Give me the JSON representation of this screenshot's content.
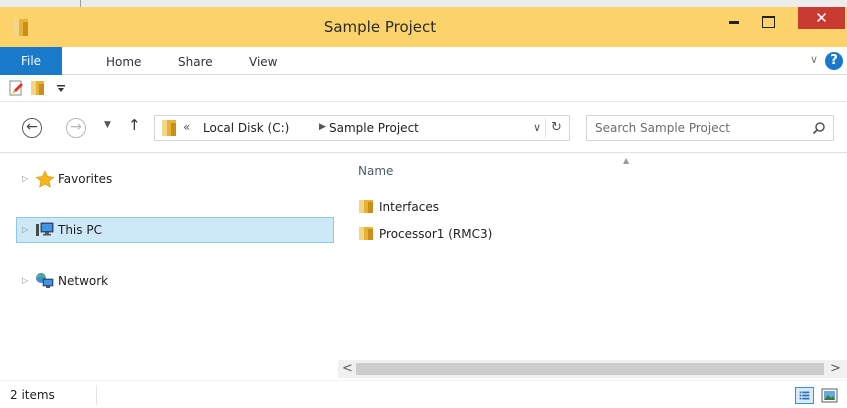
{
  "window": {
    "title": "Sample Project",
    "minimize_glyph": "–",
    "maximize_glyph": "□",
    "close_glyph": "✕",
    "colors": {
      "title_bar": "#fbd36a",
      "accent": "#1979ca",
      "close": "#c93a30",
      "selection": "#cde8f7"
    }
  },
  "ribbon": {
    "tabs": [
      {
        "label": "File"
      },
      {
        "label": "Home"
      },
      {
        "label": "Share"
      },
      {
        "label": "View"
      }
    ],
    "expand_glyph": "∨",
    "help_glyph": "?"
  },
  "quick_access": {
    "icons": [
      "properties-icon",
      "new-folder-icon",
      "customize-dropdown-icon"
    ]
  },
  "navigation": {
    "back_glyph": "←",
    "forward_glyph": "→",
    "recent_glyph": "▼",
    "up_glyph": "↑",
    "address": {
      "overflow_glyph": "«",
      "separator_glyph": "▶",
      "crumbs": [
        {
          "label": "Local Disk (C:)"
        },
        {
          "label": "Sample Project"
        }
      ],
      "dropdown_glyph": "∨",
      "refresh_glyph": "↻"
    },
    "search": {
      "placeholder": "Search Sample Project"
    }
  },
  "nav_pane": {
    "expand_glyph": "▷",
    "items": [
      {
        "label": "Favorites",
        "icon": "star-icon",
        "selected": false
      },
      {
        "label": "This PC",
        "icon": "computer-icon",
        "selected": true
      },
      {
        "label": "Network",
        "icon": "network-icon",
        "selected": false
      }
    ]
  },
  "content": {
    "columns": [
      {
        "label": "Name",
        "sorted": "ascending"
      }
    ],
    "sort_glyph": "▲",
    "items": [
      {
        "name": "Interfaces",
        "type": "folder"
      },
      {
        "name": "Processor1 (RMC3)",
        "type": "folder"
      }
    ]
  },
  "scrollbar": {
    "left_glyph": "<",
    "right_glyph": ">"
  },
  "status": {
    "item_count": "2 items",
    "views": [
      "details-view-icon",
      "large-icons-view-icon"
    ]
  }
}
